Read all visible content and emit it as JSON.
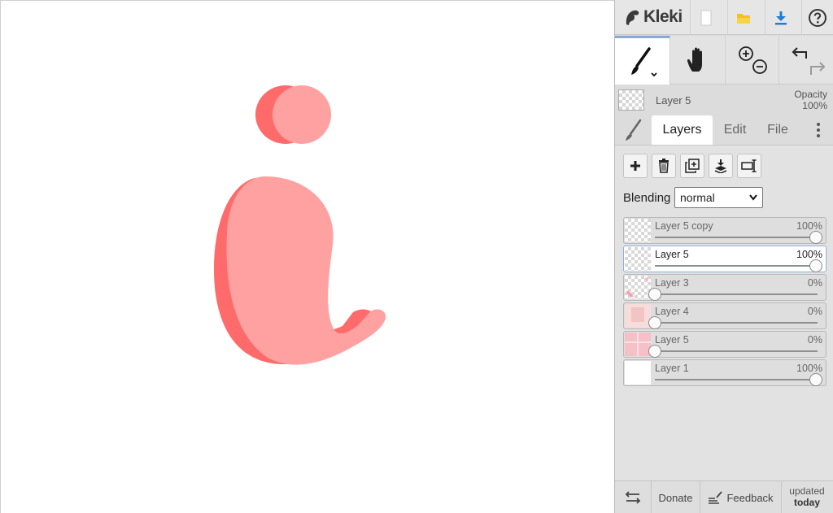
{
  "app": {
    "name": "Kleki"
  },
  "colors": {
    "accent": "#8aa8d6",
    "shape_light": "#ffa1a1",
    "shape_dark": "#ff6b6b"
  },
  "topbar": {
    "icons": [
      "kleki-logo-icon",
      "new-image-icon",
      "folder-icon",
      "download-icon",
      "help-icon"
    ]
  },
  "toolbar": {
    "tools": [
      {
        "name": "brush-icon",
        "active": true
      },
      {
        "name": "hand-icon",
        "active": false
      },
      {
        "name": "zoom-icon",
        "active": false
      },
      {
        "name": "undo-redo-icon",
        "active": false
      }
    ]
  },
  "current_layer": {
    "name": "Layer 5",
    "opacity_label": "Opacity",
    "opacity_value": "100%"
  },
  "tabs": [
    {
      "label": "Layers",
      "active": true
    },
    {
      "label": "Edit",
      "active": false
    },
    {
      "label": "File",
      "active": false
    }
  ],
  "layer_actions": [
    "add-layer-icon",
    "delete-layer-icon",
    "duplicate-layer-icon",
    "merge-down-icon",
    "rename-layer-icon"
  ],
  "blending": {
    "label": "Blending",
    "value": "normal"
  },
  "layers": [
    {
      "name": "Layer 5 copy",
      "opacity": "100%",
      "opacity_value": 1.0,
      "selected": false
    },
    {
      "name": "Layer 5",
      "opacity": "100%",
      "opacity_value": 1.0,
      "selected": true
    },
    {
      "name": "Layer 3",
      "opacity": "0%",
      "opacity_value": 0.0,
      "selected": false
    },
    {
      "name": "Layer 4",
      "opacity": "0%",
      "opacity_value": 0.0,
      "selected": false
    },
    {
      "name": "Layer 5",
      "opacity": "0%",
      "opacity_value": 0.0,
      "selected": false
    },
    {
      "name": "Layer 1",
      "opacity": "100%",
      "opacity_value": 1.0,
      "selected": false
    }
  ],
  "footer": {
    "donate_label": "Donate",
    "feedback_label": "Feedback",
    "updated_label": "updated",
    "updated_value": "today"
  }
}
